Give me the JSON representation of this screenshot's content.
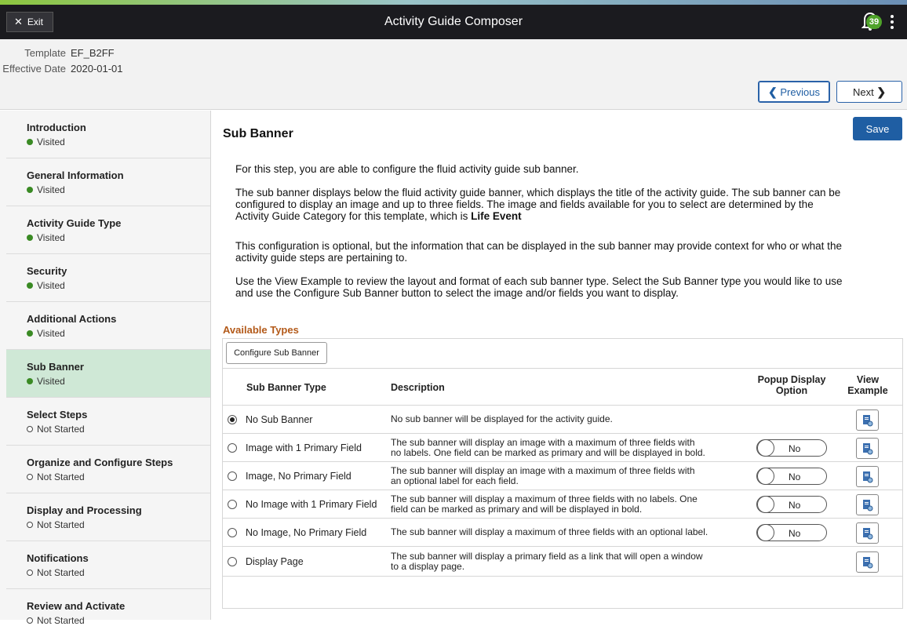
{
  "header": {
    "exit_label": "Exit",
    "title": "Activity Guide Composer",
    "notification_count": "39"
  },
  "context": {
    "template_label": "Template",
    "template_value": "EF_B2FF",
    "effective_date_label": "Effective Date",
    "effective_date_value": "2020-01-01"
  },
  "nav": {
    "previous_label": "Previous",
    "next_label": "Next"
  },
  "sidebar": {
    "items": [
      {
        "label": "Introduction",
        "status": "Visited"
      },
      {
        "label": "General Information",
        "status": "Visited"
      },
      {
        "label": "Activity Guide Type",
        "status": "Visited"
      },
      {
        "label": "Security",
        "status": "Visited"
      },
      {
        "label": "Additional Actions",
        "status": "Visited"
      },
      {
        "label": "Sub Banner",
        "status": "Visited"
      },
      {
        "label": "Select Steps",
        "status": "Not Started"
      },
      {
        "label": "Organize and Configure Steps",
        "status": "Not Started"
      },
      {
        "label": "Display and Processing",
        "status": "Not Started"
      },
      {
        "label": "Notifications",
        "status": "Not Started"
      },
      {
        "label": "Review and Activate",
        "status": "Not Started"
      }
    ]
  },
  "main": {
    "title": "Sub Banner",
    "save_label": "Save",
    "para1": "For this step, you are able to configure the fluid activity guide sub banner.",
    "para2_line1": "The sub banner displays below the fluid activity guide banner, which displays the title of the activity guide. The sub banner can be",
    "para2_line2": "configured to display an image and up to three fields. The image and fields available for you to select are determined by the",
    "para2_line3": "Activity Guide Category for this template, which is ",
    "para2_bold": "Life Event",
    "para3_line1": "This configuration is optional, but the information that can be displayed in the sub banner may provide context for who or what the",
    "para3_line2": "activity guide steps are pertaining to.",
    "para4_line1": "Use the View Example to review the layout and format of each sub banner type. Select the Sub Banner type you would like to use",
    "para4_line2": "and use the Configure Sub Banner button to select the image and/or fields you want to display.",
    "section_title": "Available Types",
    "configure_label": "Configure Sub Banner",
    "columns": {
      "type": "Sub Banner Type",
      "description": "Description",
      "popup_line1": "Popup Display",
      "popup_line2": "Option",
      "view_line1": "View",
      "view_line2": "Example"
    },
    "rows": [
      {
        "type": "No Sub Banner",
        "selected": true,
        "desc1": "No sub banner will be displayed for the activity guide.",
        "desc2": "",
        "toggle": ""
      },
      {
        "type": "Image with 1 Primary Field",
        "selected": false,
        "desc1": "The sub banner will display an image with a maximum of three fields with",
        "desc2": "no labels.  One field can be marked as primary and will be displayed in bold.",
        "toggle": "No"
      },
      {
        "type": "Image, No Primary Field",
        "selected": false,
        "desc1": "The sub banner will display an image with a maximum of three fields with",
        "desc2": "an optional label for each field.",
        "toggle": "No"
      },
      {
        "type": "No Image with 1 Primary Field",
        "selected": false,
        "desc1": "The sub banner will display a maximum of three fields with no labels.  One",
        "desc2": "field can be marked as primary and will be displayed in bold.",
        "toggle": "No"
      },
      {
        "type": "No Image, No Primary Field",
        "selected": false,
        "desc1": "The sub banner will display a maximum of three fields with an optional label.",
        "desc2": "",
        "toggle": "No"
      },
      {
        "type": "Display Page",
        "selected": false,
        "desc1": "The sub banner will display a primary field as a link that will open a window",
        "desc2": "to a display page.",
        "toggle": ""
      }
    ]
  },
  "colors": {
    "header_bg": "#1b1b1f",
    "accent_green": "#4fa32a",
    "primary_blue": "#1f5ea3",
    "section_orange": "#b35a1a",
    "active_step_bg": "#cfe8d6"
  },
  "icons": {
    "exit": "close-icon",
    "notifications": "bell-icon",
    "actions": "kebab-menu-icon",
    "previous": "chevron-left-icon",
    "next": "chevron-right-icon",
    "view_example": "document-preview-icon"
  }
}
